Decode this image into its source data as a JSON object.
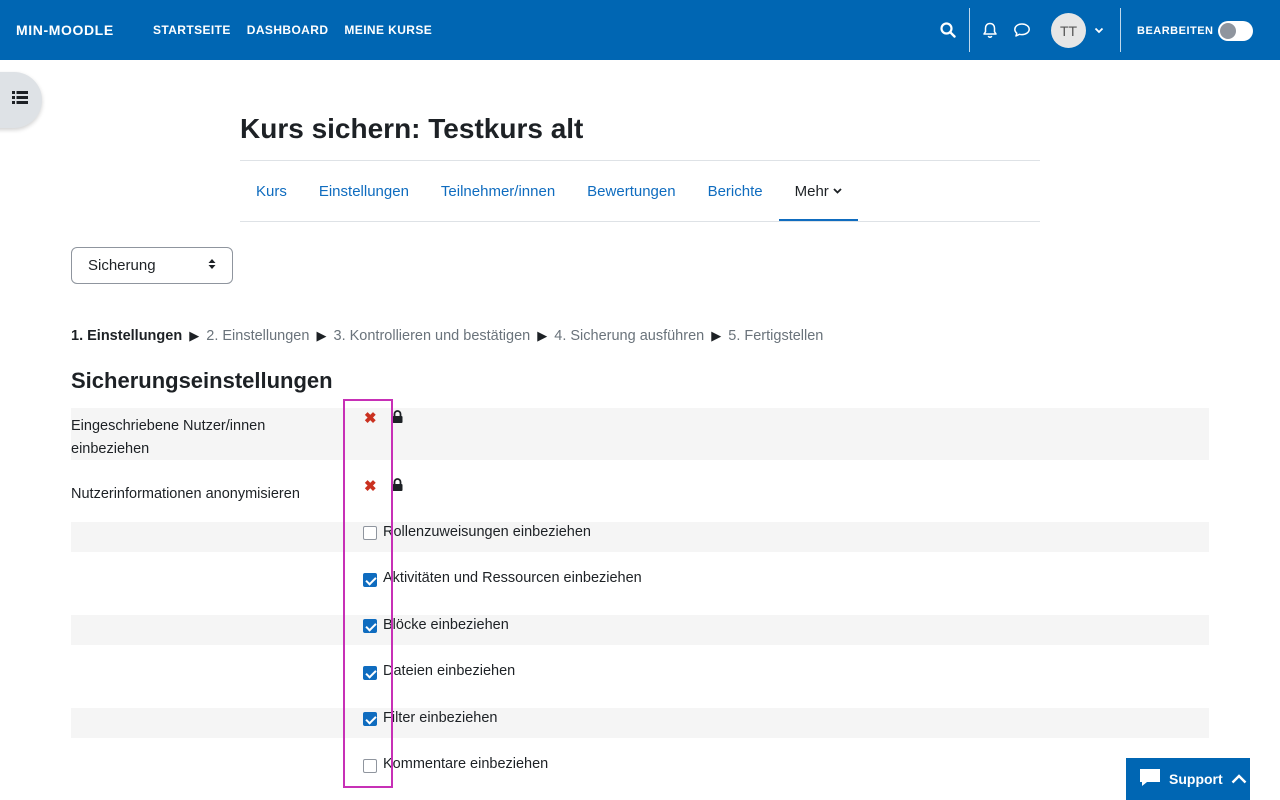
{
  "navbar": {
    "brand": "MIN-MOODLE",
    "links": [
      "STARTSEITE",
      "DASHBOARD",
      "MEINE KURSE"
    ],
    "avatar_initials": "TT",
    "edit_label": "BEARBEITEN"
  },
  "header": {
    "title": "Kurs sichern: Testkurs alt",
    "tabs": [
      "Kurs",
      "Einstellungen",
      "Teilnehmer/innen",
      "Bewertungen",
      "Berichte",
      "Mehr"
    ]
  },
  "select": {
    "value": "Sicherung"
  },
  "progress": {
    "current": "1. Einstellungen",
    "steps": [
      "2. Einstellungen",
      "3. Kontrollieren und bestätigen",
      "4. Sicherung ausführen",
      "5. Fertigstellen"
    ]
  },
  "settings": {
    "title": "Sicherungseinstellungen",
    "locked": [
      {
        "label_line1": "Eingeschriebene Nutzer/innen",
        "label_line2": "einbeziehen"
      },
      {
        "label_line1": "Nutzerinformationen anonymisieren"
      }
    ],
    "checkboxes": [
      {
        "label": "Rollenzuweisungen einbeziehen",
        "checked": false
      },
      {
        "label": "Aktivitäten und Ressourcen einbeziehen",
        "checked": true
      },
      {
        "label": "Blöcke einbeziehen",
        "checked": true
      },
      {
        "label": "Dateien einbeziehen",
        "checked": true
      },
      {
        "label": "Filter einbeziehen",
        "checked": true
      },
      {
        "label": "Kommentare einbeziehen",
        "checked": false
      }
    ]
  },
  "support": {
    "label": "Support"
  },
  "colors": {
    "navbar": "#0066b3",
    "link": "#0f6cbf",
    "highlight": "#c730b6",
    "xmark": "#ca3120"
  }
}
